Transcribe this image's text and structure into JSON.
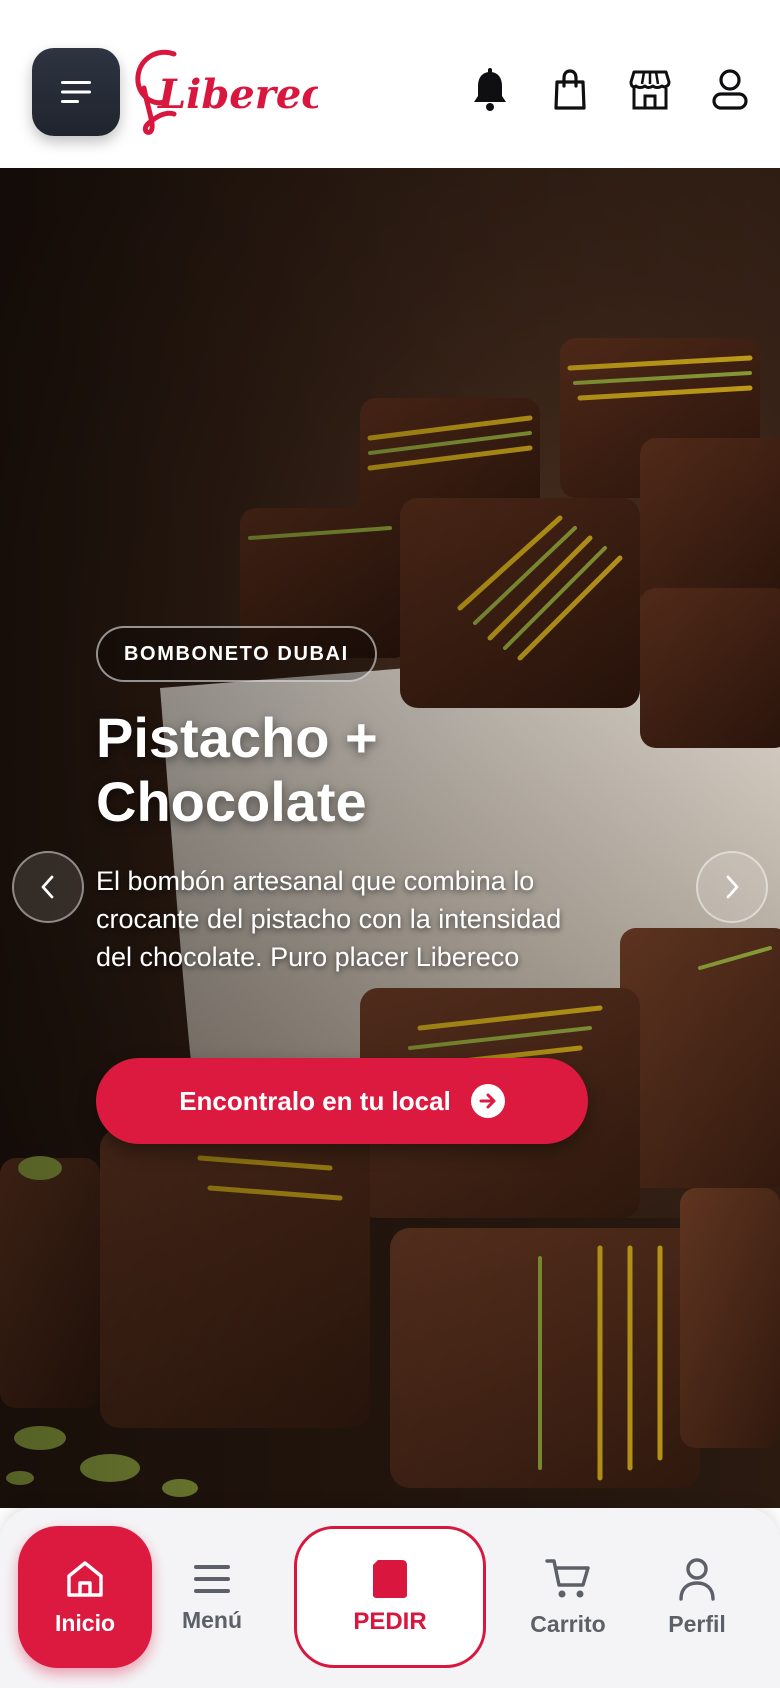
{
  "header": {
    "logo_text": "Libereco",
    "icons": [
      "menu-icon",
      "bell-icon",
      "shopping-bag-icon",
      "store-icon",
      "user-icon"
    ]
  },
  "hero": {
    "badge": "BOMBONETO DUBAI",
    "title_line1": "Pistacho +",
    "title_line2": "Chocolate",
    "description": "El bombón artesanal que combina lo crocante del pistacho con la intensidad del chocolate. Puro placer Libereco",
    "cta_label": "Encontralo en tu local"
  },
  "bottom_nav": {
    "home": "Inicio",
    "menu": "Menú",
    "order": "PEDIR",
    "cart": "Carrito",
    "profile": "Perfil"
  },
  "colors": {
    "brand_red": "#dc1a40",
    "dark_button": "#272c36",
    "nav_text": "#5d6068"
  }
}
